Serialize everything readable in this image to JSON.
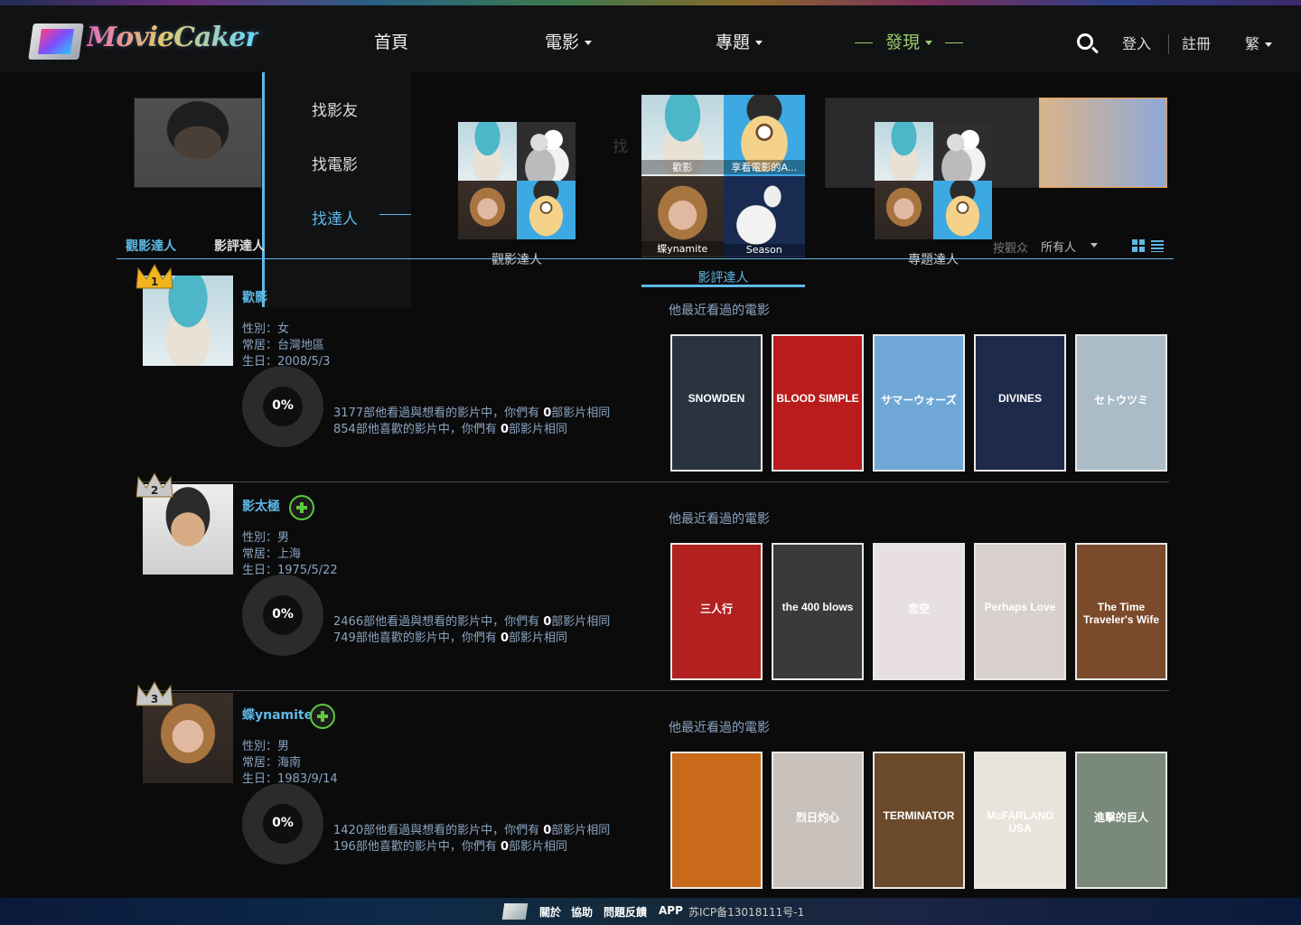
{
  "nav": {
    "logo": "MovieCaker",
    "home": "首頁",
    "movies": "電影",
    "topics": "專題",
    "discover": "發現",
    "login": "登入",
    "register": "註冊",
    "lang": "繁"
  },
  "discover_menu": {
    "items": [
      "找影友",
      "找電影",
      "找達人"
    ],
    "active_index": 2
  },
  "mega": {
    "cards": [
      {
        "label": "觀影達人"
      },
      {
        "label": "影評達人",
        "tile_labels": [
          "歡影",
          "享看電影的A...",
          "蝶ynamite",
          "Season"
        ]
      },
      {
        "label": "專題達人"
      }
    ],
    "bg_text": "找"
  },
  "tabs": {
    "items": [
      "觀影達人",
      "影評達人"
    ],
    "active_index": 0,
    "filter_label": "按觀众",
    "select_value": "所有人"
  },
  "users": [
    {
      "rank": "1",
      "crown": "gold",
      "name": "歡影",
      "show_add": false,
      "gender": "性別：女",
      "location": "常居：台灣地區",
      "birthday": "生日：2008/5/3",
      "match": "0%",
      "stat1_pre": "3177部他看過與想看的影片中，你們有 ",
      "stat1_num": "0",
      "stat1_post": "部影片相同",
      "stat2_pre": "854部他喜歡的影片中，你們有 ",
      "stat2_num": "0",
      "stat2_post": "部影片相同",
      "recent_label": "他最近看過的電影",
      "posters": [
        {
          "text": "SNOWDEN",
          "bg": "#2a3440"
        },
        {
          "text": "BLOOD SIMPLE",
          "bg": "#b81c1c"
        },
        {
          "text": "サマーウォーズ",
          "bg": "#6fa8d6"
        },
        {
          "text": "DIVINES",
          "bg": "#1e2a4a"
        },
        {
          "text": "セトウツミ",
          "bg": "#a9bcc8"
        }
      ]
    },
    {
      "rank": "2",
      "crown": "silver",
      "name": "影太極",
      "show_add": true,
      "gender": "性別：男",
      "location": "常居：上海",
      "birthday": "生日：1975/5/22",
      "match": "0%",
      "stat1_pre": "2466部他看過與想看的影片中，你們有 ",
      "stat1_num": "0",
      "stat1_post": "部影片相同",
      "stat2_pre": "749部他喜歡的影片中，你們有 ",
      "stat2_num": "0",
      "stat2_post": "部影片相同",
      "recent_label": "他最近看過的電影",
      "posters": [
        {
          "text": "三人行",
          "bg": "#b32020"
        },
        {
          "text": "the 400 blows",
          "bg": "#3a3a3a"
        },
        {
          "text": "恋空",
          "bg": "#e8e0e0"
        },
        {
          "text": "Perhaps Love",
          "bg": "#d8d0cc"
        },
        {
          "text": "The Time Traveler's Wife",
          "bg": "#7a4a2a"
        }
      ]
    },
    {
      "rank": "3",
      "crown": "silver",
      "name": "蝶ynamite",
      "show_add": true,
      "gender": "性別：男",
      "location": "常居：海南",
      "birthday": "生日：1983/9/14",
      "match": "0%",
      "stat1_pre": "1420部他看過與想看的影片中，你們有 ",
      "stat1_num": "0",
      "stat1_post": "部影片相同",
      "stat2_pre": "196部他喜歡的影片中，你們有 ",
      "stat2_num": "0",
      "stat2_post": "部影片相同",
      "recent_label": "他最近看過的電影",
      "posters": [
        {
          "text": "",
          "bg": "#c86a1a"
        },
        {
          "text": "烈日灼心",
          "bg": "#c9c2bc"
        },
        {
          "text": "TERMINATOR",
          "bg": "#6a4a2a"
        },
        {
          "text": "McFARLAND USA",
          "bg": "#e8e4dc"
        },
        {
          "text": "進擊的巨人",
          "bg": "#7a8a7a"
        }
      ]
    }
  ],
  "footer": {
    "links": [
      "關於",
      "協助",
      "問題反饋",
      "APP"
    ],
    "icp": "苏ICP备13018111号-1"
  },
  "colors": {
    "accent": "#5fb8e6",
    "discover": "#9acd6f",
    "add": "#5ec93d"
  }
}
